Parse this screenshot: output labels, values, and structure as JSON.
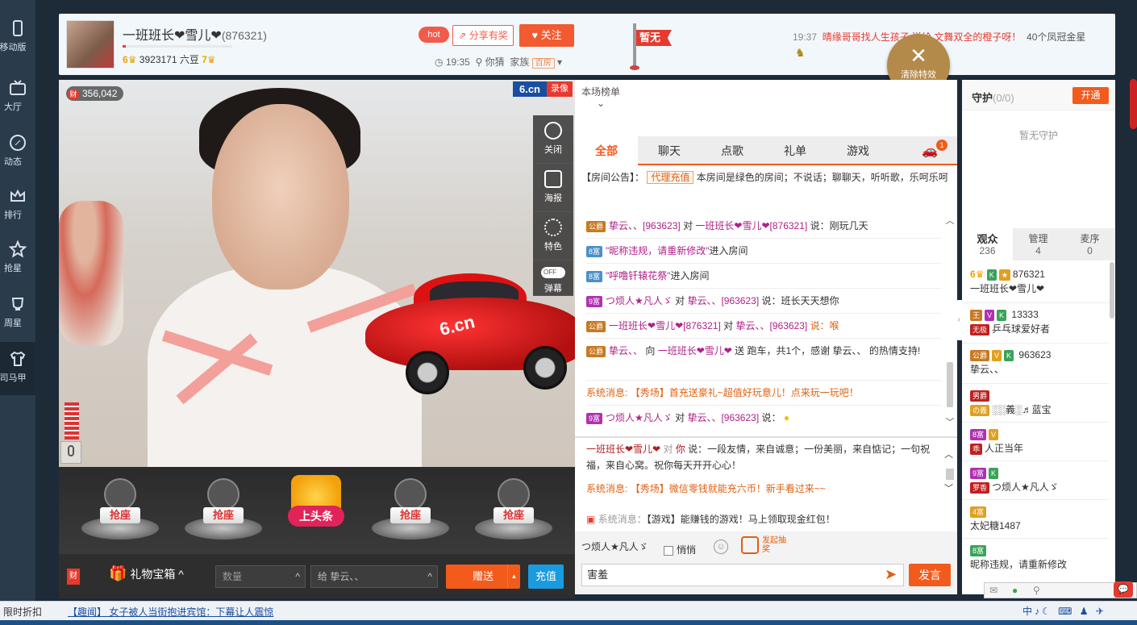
{
  "leftnav": [
    {
      "label": "移动版",
      "icon": "phone-icon"
    },
    {
      "label": "大厅",
      "icon": "tv-icon"
    },
    {
      "label": "动态",
      "icon": "compass-icon"
    },
    {
      "label": "排行",
      "icon": "crown-icon"
    },
    {
      "label": "抢星",
      "icon": "star-icon"
    },
    {
      "label": "周星",
      "icon": "cup-icon"
    },
    {
      "label": "司马甲",
      "icon": "shirt-icon"
    }
  ],
  "anchor": {
    "name": "一班班长❤雪儿❤",
    "room_id": "(876321)",
    "level_left": "6",
    "beans": "3923171 六豆",
    "level_right": "7",
    "hot": "hot",
    "share": "分享有奖",
    "follow": "关注",
    "time": "19:35",
    "location": "你猜",
    "family_label": "家族",
    "family_tag": "百房"
  },
  "flag": {
    "text": "暂无"
  },
  "ticker": {
    "time": "19:37",
    "text": "晴缘哥哥找人生孩子 送给 文舞双全的橙子呀！",
    "suffix": "40个凤冠金星"
  },
  "clear_effects": "清除特效",
  "video": {
    "balance": "356,042",
    "logo_a": "6.cn",
    "logo_b": "录像",
    "controls": [
      {
        "label": "关闭",
        "icon": "power-icon"
      },
      {
        "label": "海报",
        "icon": "poster-icon"
      },
      {
        "label": "特色",
        "icon": "grid-icon"
      },
      {
        "label": "弹幕",
        "icon": "barrage-toggle-icon",
        "toggle": "OFF"
      }
    ],
    "car_text": "6.cn"
  },
  "seats": {
    "seat_label": "抢座",
    "headline": "上头条"
  },
  "giftbar": {
    "cai": "财",
    "giftbox": "礼物宝箱",
    "qty_placeholder": "数量",
    "to": "给 挚云、、",
    "send": "赠送",
    "recharge": "充值"
  },
  "chat": {
    "rank": "本场榜单",
    "tabs": [
      "全部",
      "聊天",
      "点歌",
      "礼单",
      "游戏"
    ],
    "car_badge": "1",
    "notice_label": "【房间公告】：",
    "notice_proxy": "代理充值",
    "notice_text": "本房间是绿色的房间；不说话；聊聊天，听听歌，乐呵乐呵",
    "messages": [
      {
        "badge": "公爵",
        "badge_color": "gold",
        "text_user": "挚云、、[963623]",
        "text_mid": " 对 ",
        "text_target": "一班班长❤雪儿❤[876321]",
        "text_end": " 说：刚玩几天"
      },
      {
        "badge": "8富",
        "badge_color": "blue",
        "text_user": "",
        "text_mid": "",
        "text_target": "\"昵称违规，请重新修改\"",
        "text_end": "进入房间"
      },
      {
        "badge": "8富",
        "badge_color": "blue",
        "text_user": "",
        "text_mid": "",
        "text_target": "\"呼噜钎辕花祭\"",
        "text_end": "进入房间"
      },
      {
        "badge": "9富",
        "badge_color": "purple",
        "text_user": "つ烦人★凡人ゞ",
        "text_mid": " 对 ",
        "text_target": "挚云、、[963623]",
        "text_end": " 说：班长天天想你"
      },
      {
        "badge": "公爵",
        "badge_color": "gold",
        "text_user": "一班班长❤雪儿❤[876321]",
        "text_mid": " 对 ",
        "text_target": "挚云、、[963623]",
        "text_end": " 说：喉"
      },
      {
        "badge": "公爵",
        "badge_color": "gold",
        "text_user": "挚云、、",
        "text_mid": " 向 ",
        "text_target": "一班班长❤雪儿❤",
        "text_end": " 送 跑车，共1个，感谢 挚云、、 的热情支持!"
      },
      {
        "badge": "",
        "badge_color": "",
        "text_user": "系统消息:",
        "text_mid": "",
        "text_target": "【秀场】首充送豪礼~超值好玩意儿！点来玩一玩吧！",
        "text_end": ""
      },
      {
        "badge": "9富",
        "badge_color": "purple",
        "text_user": "つ烦人★凡人ゞ",
        "text_mid": " 对 ",
        "text_target": "挚云、、[963623]",
        "text_end": " 说："
      }
    ],
    "messages2": [
      {
        "user": "一班班长❤雪儿❤",
        "mid": " 对 ",
        "target": "你",
        "end": " 说：一段友情，来自诚意；一份美丽，来自惦记；一句祝福，来自心窝。祝你每天开开心心！"
      },
      {
        "user": "系统消息:",
        "mid": "",
        "target": "【秀场】微信零钱就能充六币！新手看过来~~",
        "end": ""
      },
      {
        "user": "系统消息：",
        "mid": "",
        "target": "【游戏】能赚钱的游戏！马上领取现金红包！",
        "end": ""
      }
    ],
    "target_user": "つ烦人★凡人ゞ",
    "quiet": "悄悄",
    "lottery": "发起抽奖",
    "input_value": "害羞",
    "speak": "发言"
  },
  "right": {
    "guard_title": "守护",
    "guard_count": "(0/0)",
    "open": "开通",
    "no_guard": "暂无守护",
    "tabs": [
      {
        "label": "观众",
        "count": "236"
      },
      {
        "label": "管理",
        "count": "4"
      },
      {
        "label": "麦序",
        "count": "0"
      }
    ],
    "users": [
      {
        "badges": [
          "6",
          "K",
          "★"
        ],
        "id": "876321",
        "name": "一班班长❤雪儿❤"
      },
      {
        "badges": [
          "王",
          "V",
          "K"
        ],
        "id": "13333",
        "prefix": "无极",
        "name": "乒乓球爱好者"
      },
      {
        "badges": [
          "公爵",
          "V",
          "K"
        ],
        "id": "963623",
        "name": "挚云、、"
      },
      {
        "badges": [
          "男爵"
        ],
        "id": "",
        "prefix": "の義",
        "name": "░░義░♬蓝宝"
      },
      {
        "badges": [
          "8富",
          "V"
        ],
        "id": "",
        "prefix": "乖",
        "name": "人正当年"
      },
      {
        "badges": [
          "9富",
          "K"
        ],
        "id": "",
        "prefix": "罗香",
        "name": "つ烦人★凡人ゞ"
      },
      {
        "badges": [
          "4富"
        ],
        "id": "",
        "name": "太妃糖1487"
      },
      {
        "badges": [
          "8富"
        ],
        "id": "",
        "name": "昵称违规，请重新修改"
      }
    ]
  },
  "bottom": {
    "limit": "限时折扣",
    "news": "【趣闻】 女子被人当街抱进宾馆：下幕让人震惊",
    "tray": "中♪☾ ⌨ ♟ ✈"
  },
  "colors": {
    "accent": "#f25b1c",
    "blue": "#1a9be0",
    "nav": "#2a3b4c"
  }
}
